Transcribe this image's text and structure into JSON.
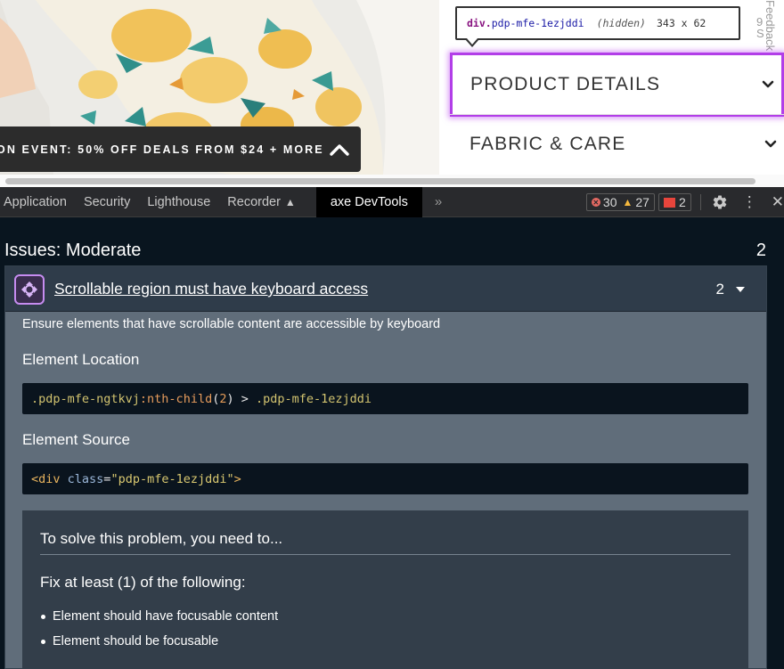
{
  "webpage": {
    "promo_text": "ON EVENT: 50% OFF DEALS FROM $24 + MORE",
    "side_text_top": "9",
    "side_text_bottom": "S",
    "feedback_label": "Feedback",
    "accordion": [
      {
        "label": "PRODUCT DETAILS",
        "icon": "chevron-down-icon"
      },
      {
        "label": "FABRIC & CARE",
        "icon": "chevron-down-icon"
      }
    ],
    "inspect_tooltip": {
      "tag": "div",
      "class_name": "pdp-mfe-1ezjddi",
      "state": "(hidden)",
      "size": "343 x 62"
    }
  },
  "devtools": {
    "tabs": [
      {
        "label": "Application",
        "active": false
      },
      {
        "label": "Security",
        "active": false
      },
      {
        "label": "Lighthouse",
        "active": false
      },
      {
        "label": "Recorder",
        "active": false,
        "icon": "flask-icon"
      },
      {
        "label": "axe DevTools",
        "active": true
      }
    ],
    "more_tabs": "»",
    "errors": "30",
    "warnings": "27",
    "issues": "2",
    "colors": {
      "error": "#e46962",
      "warning": "#f5b83d",
      "issue": "#e8453c",
      "focus_outline": "#b23ee8"
    }
  },
  "axe": {
    "heading": "Issues: Moderate",
    "heading_count": "2",
    "issue": {
      "title": "Scrollable region must have keyboard access",
      "count": "2",
      "description": "Ensure elements that have scrollable content are accessible by keyboard",
      "location_heading": "Element Location",
      "location_code": {
        "sel_1": ".pdp-mfe-ngtkvj",
        "pseudo": ":nth-child",
        "paren_open": "(",
        "num": "2",
        "paren_close": ")",
        "combinator": " > ",
        "sel_2": ".pdp-mfe-1ezjddi"
      },
      "source_heading": "Element Source",
      "source_code": {
        "open": "<div",
        "attr": " class",
        "eq": "=",
        "value": "\"pdp-mfe-1ezjddi\"",
        "close": ">"
      },
      "solve_title": "To solve this problem, you need to...",
      "fix_title": "Fix at least (1) of the following:",
      "fixes": [
        "Element should have focusable content",
        "Element should be focusable"
      ]
    }
  }
}
